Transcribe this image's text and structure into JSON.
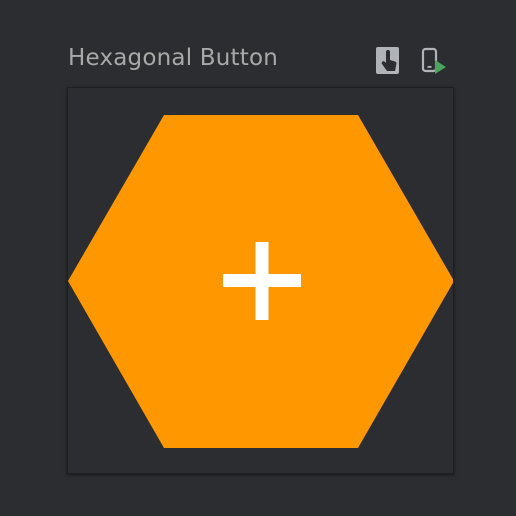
{
  "preview": {
    "title": "Hexagonal Button"
  },
  "toolbar": {
    "interactive_mode_icon": "touch-hand-icon",
    "deploy_icon": "device-run-icon"
  },
  "hex_button": {
    "fill_color": "#ff9800",
    "icon": "plus-icon",
    "icon_color": "#ffffff"
  }
}
